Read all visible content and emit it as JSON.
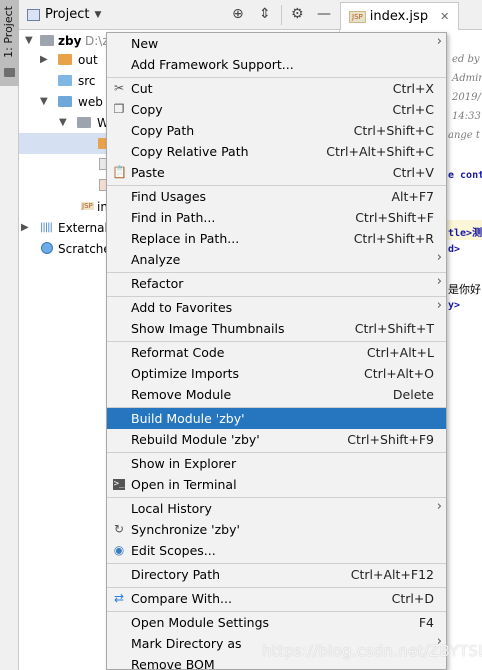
{
  "tool_strip": {
    "project_tab": "1: Project"
  },
  "header": {
    "title": "Project",
    "file_tab": {
      "badge": "JSP",
      "name": "index.jsp"
    }
  },
  "tree": {
    "root": {
      "name": "zby",
      "path": "D:\\z"
    },
    "items": [
      {
        "label": "out"
      },
      {
        "label": "src"
      },
      {
        "label": "web"
      },
      {
        "label": "W"
      },
      {
        "label": "in"
      },
      {
        "label": "External"
      },
      {
        "label": "Scratche"
      }
    ]
  },
  "editor": {
    "lines": [
      "ed by",
      "Admin",
      "2019/",
      "14:33",
      "ange t",
      "e cont",
      "tle>测",
      "d>",
      "是你好",
      "y>"
    ]
  },
  "menu": {
    "items": [
      {
        "label": "New",
        "shortcut": "",
        "submenu": true
      },
      {
        "label": "Add Framework Support...",
        "shortcut": ""
      },
      {
        "label": "Cut",
        "shortcut": "Ctrl+X",
        "icon": "scissors-icon"
      },
      {
        "label": "Copy",
        "shortcut": "Ctrl+C",
        "icon": "copy-icon"
      },
      {
        "label": "Copy Path",
        "shortcut": "Ctrl+Shift+C"
      },
      {
        "label": "Copy Relative Path",
        "shortcut": "Ctrl+Alt+Shift+C"
      },
      {
        "label": "Paste",
        "shortcut": "Ctrl+V",
        "icon": "paste-icon"
      },
      {
        "label": "Find Usages",
        "shortcut": "Alt+F7"
      },
      {
        "label": "Find in Path...",
        "shortcut": "Ctrl+Shift+F"
      },
      {
        "label": "Replace in Path...",
        "shortcut": "Ctrl+Shift+R"
      },
      {
        "label": "Analyze",
        "shortcut": "",
        "submenu": true
      },
      {
        "label": "Refactor",
        "shortcut": "",
        "submenu": true
      },
      {
        "label": "Add to Favorites",
        "shortcut": "",
        "submenu": true
      },
      {
        "label": "Show Image Thumbnails",
        "shortcut": "Ctrl+Shift+T"
      },
      {
        "label": "Reformat Code",
        "shortcut": "Ctrl+Alt+L"
      },
      {
        "label": "Optimize Imports",
        "shortcut": "Ctrl+Alt+O"
      },
      {
        "label": "Remove Module",
        "shortcut": "Delete"
      },
      {
        "label": "Build Module 'zby'",
        "shortcut": "",
        "highlighted": true
      },
      {
        "label": "Rebuild Module 'zby'",
        "shortcut": "Ctrl+Shift+F9"
      },
      {
        "label": "Show in Explorer",
        "shortcut": ""
      },
      {
        "label": "Open in Terminal",
        "shortcut": "",
        "icon": "terminal-icon"
      },
      {
        "label": "Local History",
        "shortcut": "",
        "submenu": true
      },
      {
        "label": "Synchronize 'zby'",
        "shortcut": "",
        "icon": "sync-icon"
      },
      {
        "label": "Edit Scopes...",
        "shortcut": "",
        "icon": "scope-icon"
      },
      {
        "label": "Directory Path",
        "shortcut": "Ctrl+Alt+F12"
      },
      {
        "label": "Compare With...",
        "shortcut": "Ctrl+D",
        "icon": "compare-icon"
      },
      {
        "label": "Open Module Settings",
        "shortcut": "F4"
      },
      {
        "label": "Mark Directory as",
        "shortcut": "",
        "submenu": true
      },
      {
        "label": "Remove BOM",
        "shortcut": ""
      }
    ]
  },
  "watermark": "https://blog.csdn.net/ZBYTSL",
  "colors": {
    "highlight": "#2675bf",
    "menu_bg": "#f2f2f2",
    "selection": "#d5e1f2"
  }
}
